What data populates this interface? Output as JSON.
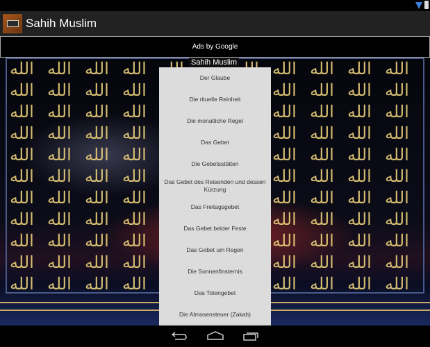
{
  "app": {
    "title": "Sahih Muslim"
  },
  "ad": {
    "label": "Ads by Google"
  },
  "background": {
    "title": "Sahih Muslim"
  },
  "menu": {
    "items": [
      "Der Glaube",
      "Die rituelle Reinheit",
      "Die monatliche Regel",
      "Das Gebet",
      "Die Gebetsstätten",
      "Das Gebet des Reisenden und dessen Kürzung",
      "Das Freitagsgebet",
      "Das Gebet beider Feste",
      "Das Gebet um Regen",
      "Die Sonnenfinsternis",
      "Das Totengebet",
      "Die Almosensteuer (Zakah)"
    ]
  },
  "colors": {
    "accent": "#3d7fd6",
    "menu_bg": "#dcdcdc",
    "gold": "#e9cf7a"
  }
}
